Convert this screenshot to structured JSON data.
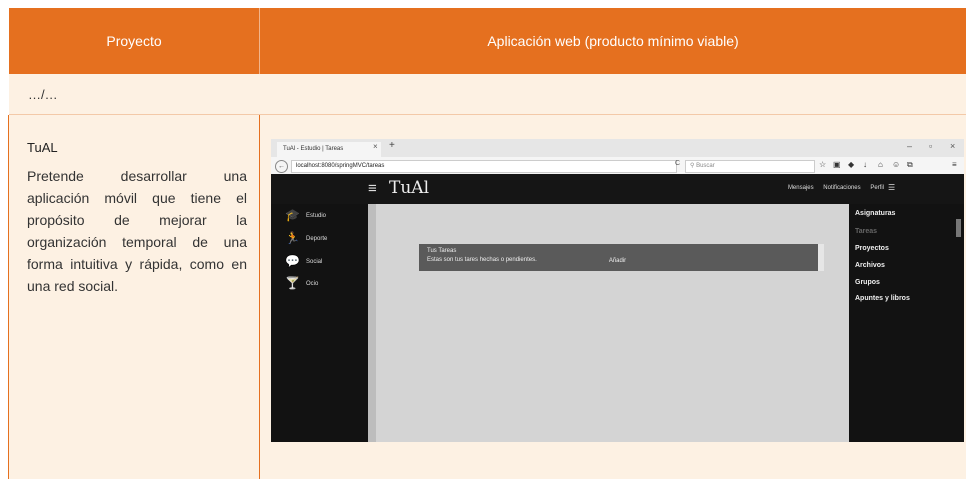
{
  "table": {
    "header_col1": "Proyecto",
    "header_col2": "Aplicación web (producto mínimo viable)",
    "continuation": "…/…",
    "project_name": "TuAL",
    "project_desc": "Pretende desarrollar una aplicación móvil que tiene el propósito de mejorar la organización temporal de una forma intuitiva y rápida, como en una red social."
  },
  "browser": {
    "tab_title": "TuAl - Estudio | Tareas",
    "url": "localhost:8080/springMVC/tareas",
    "search_placeholder": "Buscar",
    "brand": "TuAl",
    "nav": [
      "Mensajes",
      "Notificaciones",
      "Perfil"
    ],
    "left_menu": [
      "Estudio",
      "Deporte",
      "Social",
      "Ocio"
    ],
    "right_menu": [
      "Asignaturas",
      "Tareas",
      "Proyectos",
      "Archivos",
      "Grupos",
      "Apuntes y libros"
    ],
    "panel_title": "Tus Tareas",
    "panel_text": "Estas son tus tares hechas o pendientes.",
    "add_button": "Añadir"
  }
}
